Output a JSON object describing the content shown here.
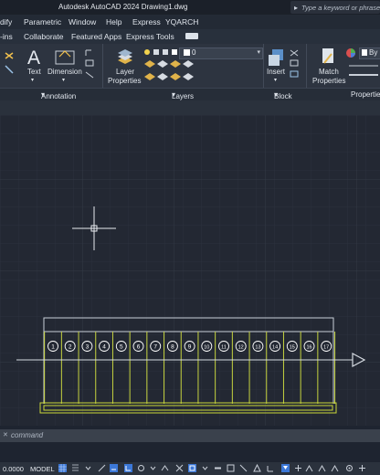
{
  "window": {
    "title": "Autodesk AutoCAD 2024    Drawing1.dwg",
    "search_placeholder": "Type a keyword or phrase"
  },
  "menu": {
    "items": [
      "dify",
      "Parametric",
      "Window",
      "Help",
      "Express",
      "YQARCH"
    ]
  },
  "tabs": {
    "items": [
      "-ins",
      "Collaborate",
      "Featured Apps",
      "Express Tools"
    ]
  },
  "ribbon": {
    "text_label": "Text",
    "dimension_label": "Dimension",
    "layer_properties_line1": "Layer",
    "layer_properties_line2": "Properties",
    "layer_value": "0",
    "insert_label": "Insert",
    "match_properties_line1": "Match",
    "match_properties_line2": "Properties",
    "bylayer_label": "By",
    "panels": {
      "annotation": "Annotation",
      "layers": "Layers",
      "block": "Block",
      "properties": "Propertie"
    }
  },
  "drawing": {
    "bubbles": [
      "1",
      "2",
      "3",
      "4",
      "5",
      "6",
      "7",
      "8",
      "9",
      "10",
      "11",
      "12",
      "13",
      "14",
      "15",
      "16",
      "17"
    ],
    "colors": {
      "frame": "#c9cfd8",
      "grid_lines": "#c6d33f",
      "base": "#cbd83a",
      "arrow": "#d6dbe2",
      "bubble": "#ffffff"
    }
  },
  "command": {
    "placeholder": "command",
    "close_glyph": "✕"
  },
  "status": {
    "coords": "0.0000",
    "model": "MODEL"
  }
}
